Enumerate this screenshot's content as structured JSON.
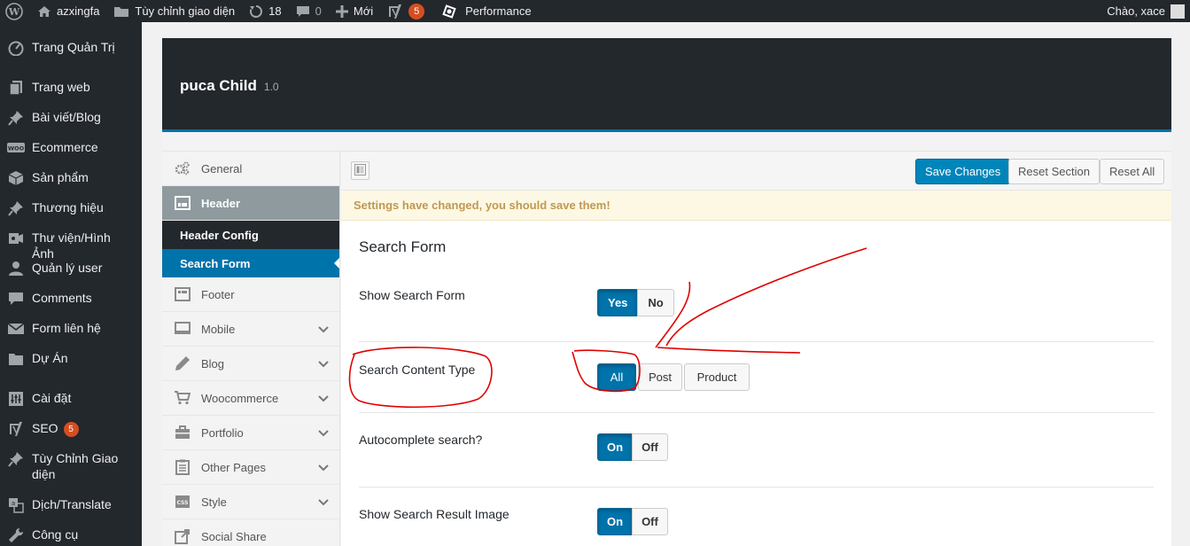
{
  "adminbar": {
    "site_name": "azxingfa",
    "customize": "Tùy chỉnh giao diện",
    "updates_count": "18",
    "comments_count": "0",
    "new_label": "Mới",
    "yoast_count": "5",
    "performance": "Performance",
    "greeting": "Chào, xace"
  },
  "menu": {
    "dashboard": "Trang Quản Trị",
    "pages": "Trang web",
    "posts": "Bài viết/Blog",
    "ecommerce": "Ecommerce",
    "products": "Sản phẩm",
    "brands": "Thương hiệu",
    "media": "Thư viện/Hình Ảnh",
    "users": "Quản lý user",
    "comments": "Comments",
    "contact": "Form liên hệ",
    "projects": "Dự Án",
    "settings": "Cài đặt",
    "seo": "SEO",
    "seo_count": "5",
    "customize_line1": "Tùy Chỉnh Giao",
    "customize_line2": "diện",
    "translate": "Dịch/Translate",
    "tools": "Công cụ"
  },
  "panel": {
    "theme_name": "puca Child",
    "version": "1.0"
  },
  "sections": {
    "general": "General",
    "header": "Header",
    "header_config": "Header Config",
    "search_form": "Search Form",
    "footer": "Footer",
    "mobile": "Mobile",
    "blog": "Blog",
    "woocommerce": "Woocommerce",
    "portfolio": "Portfolio",
    "other_pages": "Other Pages",
    "style": "Style",
    "social_share": "Social Share"
  },
  "toolbar": {
    "save": "Save Changes",
    "reset_section": "Reset Section",
    "reset_all": "Reset All"
  },
  "notice": "Settings have changed, you should save them!",
  "content": {
    "title": "Search Form",
    "show_search_form": {
      "label": "Show Search Form",
      "options": [
        "Yes",
        "No"
      ],
      "selected": "Yes"
    },
    "search_content_type": {
      "label": "Search Content Type",
      "options": [
        "All",
        "Post",
        "Product"
      ],
      "selected": "All"
    },
    "autocomplete": {
      "label": "Autocomplete search?",
      "options": [
        "On",
        "Off"
      ],
      "selected": "On"
    },
    "show_result_image": {
      "label": "Show Search Result Image",
      "options": [
        "On",
        "Off"
      ],
      "selected": "On"
    }
  },
  "colors": {
    "admin_dark": "#23282d",
    "accent_blue": "#0073aa",
    "notice_bg": "#fcf8e3",
    "annotation_red": "#e00000"
  }
}
